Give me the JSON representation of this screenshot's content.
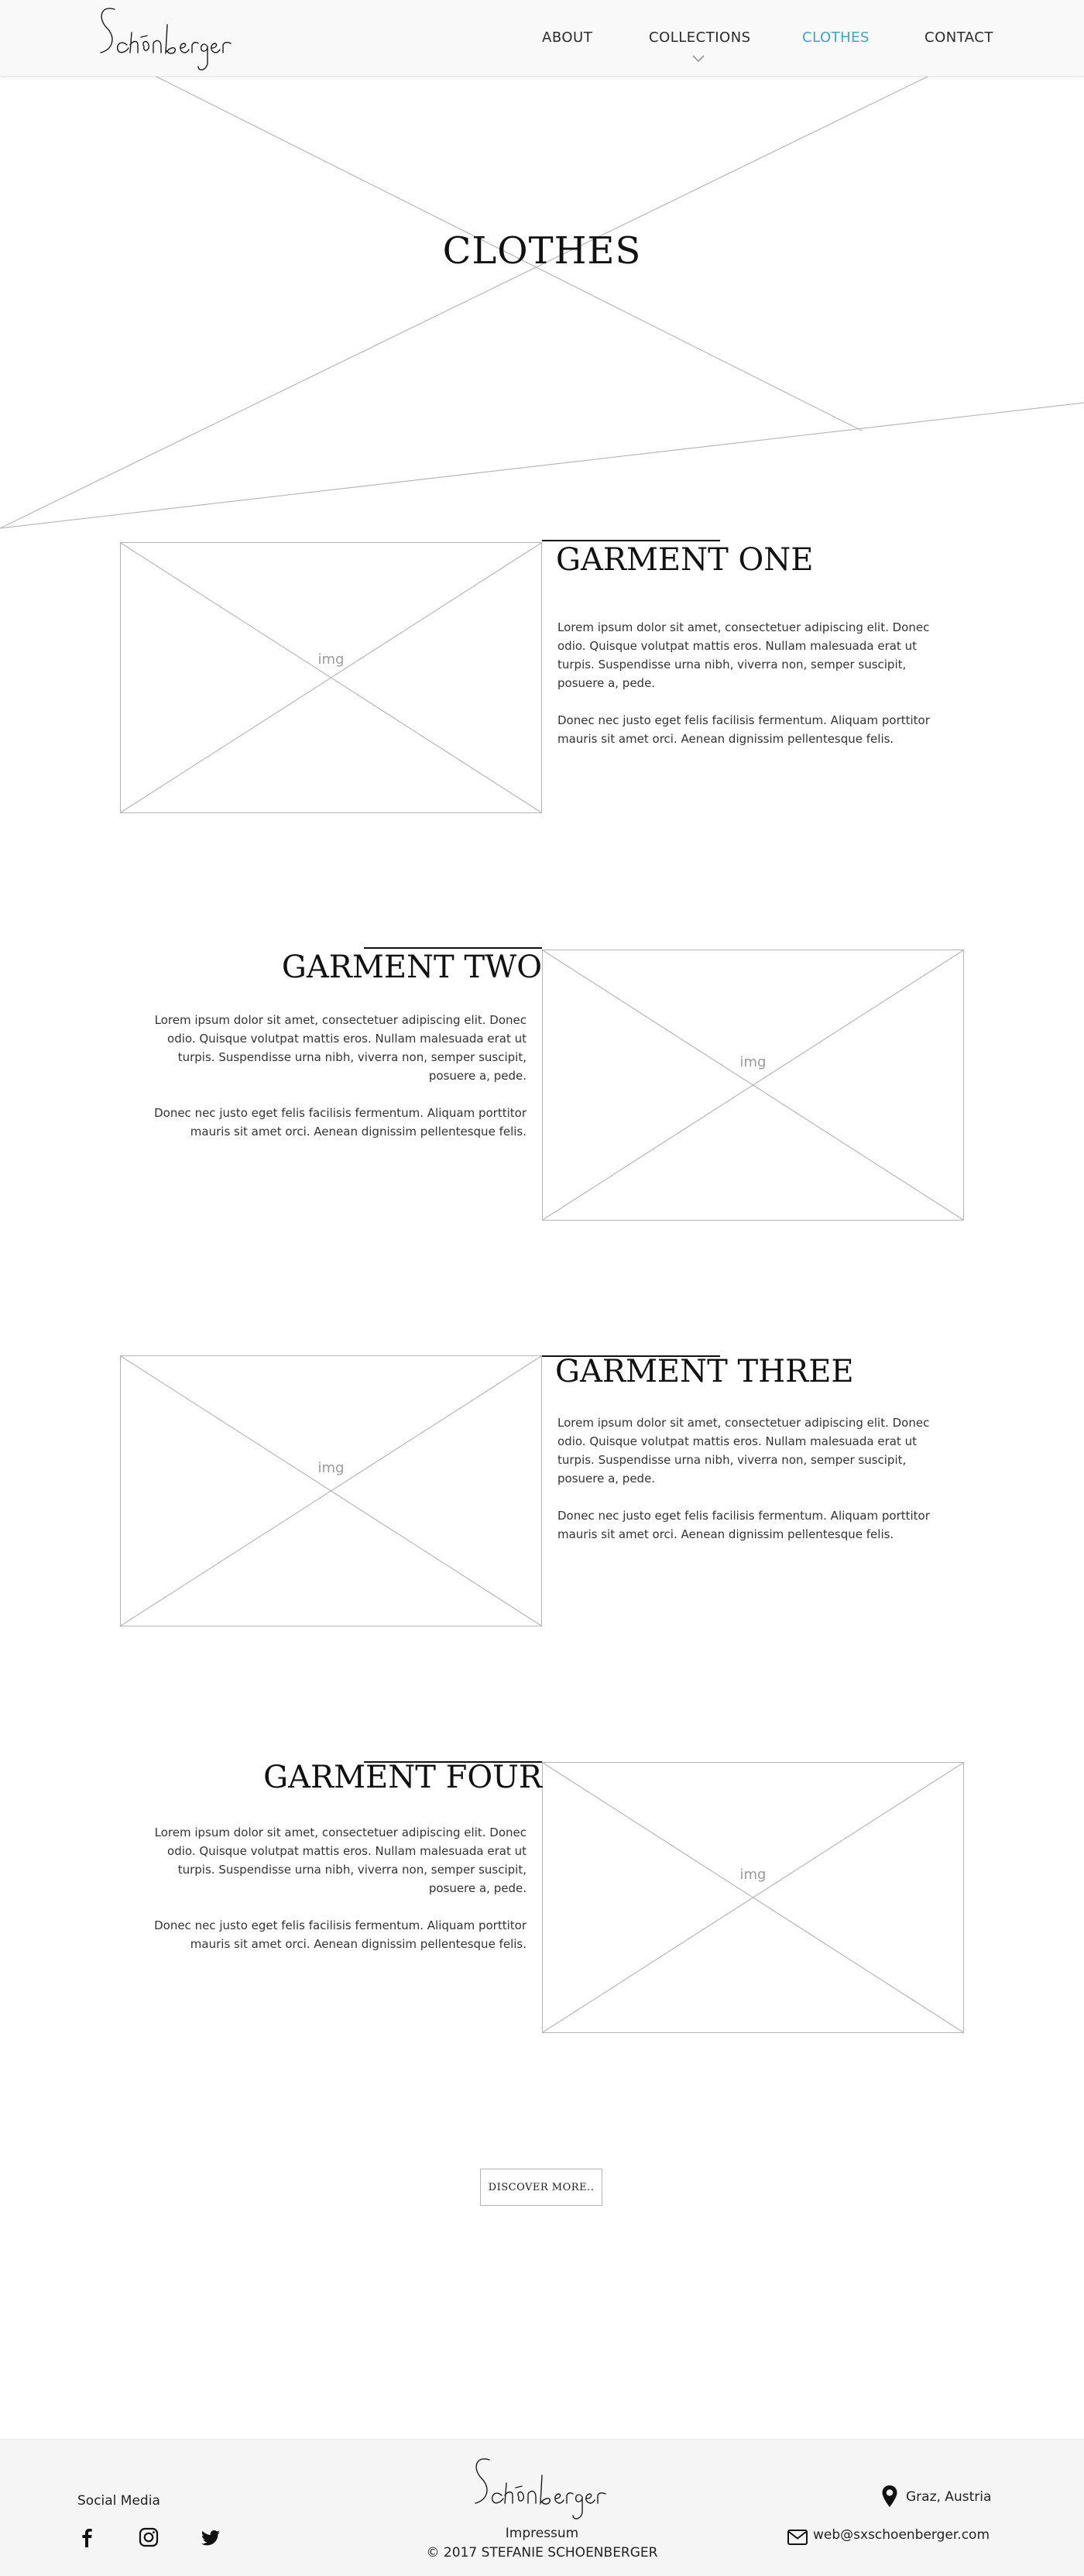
{
  "header": {
    "nav": [
      {
        "label": "ABOUT"
      },
      {
        "label": "COLLECTIONS"
      },
      {
        "label": "CLOTHES"
      },
      {
        "label": "CONTACT"
      }
    ],
    "active_color": "#3ba7c1"
  },
  "hero": {
    "title": "CLOTHES"
  },
  "garments": [
    {
      "title": "GARMENT ONE",
      "image_label": "img",
      "paragraph1": "Lorem ipsum dolor sit amet, consectetuer adipiscing elit. Donec odio. Quisque volutpat mattis eros. Nullam malesuada erat ut turpis. Suspendisse urna nibh, viverra non, semper suscipit, posuere a, pede.",
      "paragraph2": "Donec nec justo eget felis facilisis fermentum. Aliquam porttitor mauris sit amet orci. Aenean dignissim pellentesque felis."
    },
    {
      "title": "GARMENT TWO",
      "image_label": "img",
      "paragraph1": "Lorem ipsum dolor sit amet, consectetuer adipiscing elit. Donec odio. Quisque volutpat mattis eros. Nullam malesuada erat ut turpis. Suspendisse urna nibh, viverra non, semper suscipit, posuere a, pede.",
      "paragraph2": "Donec nec justo eget felis facilisis fermentum. Aliquam porttitor mauris sit amet orci. Aenean dignissim pellentesque felis."
    },
    {
      "title": "GARMENT THREE",
      "image_label": "img",
      "paragraph1": "Lorem ipsum dolor sit amet, consectetuer adipiscing elit. Donec odio. Quisque volutpat mattis eros. Nullam malesuada erat ut turpis. Suspendisse urna nibh, viverra non, semper suscipit, posuere a, pede.",
      "paragraph2": "Donec nec justo eget felis facilisis fermentum. Aliquam porttitor mauris sit amet orci. Aenean dignissim pellentesque felis."
    },
    {
      "title": "GARMENT FOUR",
      "image_label": "img",
      "paragraph1": "Lorem ipsum dolor sit amet, consectetuer adipiscing elit. Donec odio. Quisque volutpat mattis eros. Nullam malesuada erat ut turpis. Suspendisse urna nibh, viverra non, semper suscipit, posuere a, pede.",
      "paragraph2": "Donec nec justo eget felis facilisis fermentum. Aliquam porttitor mauris sit amet orci. Aenean dignissim pellentesque felis."
    }
  ],
  "discover_button": "DISCOVER MORE..",
  "footer": {
    "social_label": "Social Media",
    "social_icons": [
      "facebook-icon",
      "instagram-icon",
      "twitter-icon"
    ],
    "impressum": "Impressum",
    "copyright": "© 2017 STEFANIE SCHOENBERGER",
    "location": "Graz, Austria",
    "email": "web@sxschoenberger.com"
  }
}
